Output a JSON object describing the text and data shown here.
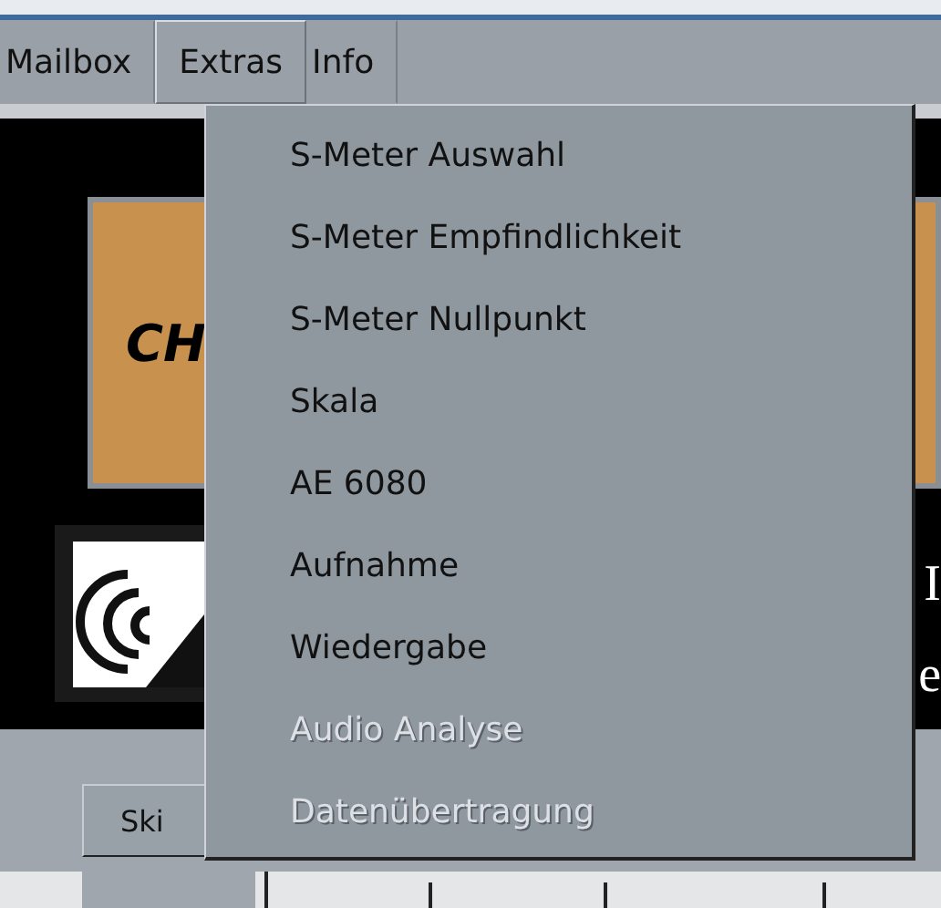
{
  "menubar": [
    {
      "label": "Mailbox",
      "selected": false
    },
    {
      "label": "Extras",
      "selected": true
    },
    {
      "label": "Info",
      "selected": false
    }
  ],
  "dropdown": {
    "items": [
      {
        "label": "S-Meter Auswahl",
        "disabled": false
      },
      {
        "label": "S-Meter Empfindlichkeit",
        "disabled": false
      },
      {
        "label": "S-Meter Nullpunkt",
        "disabled": false
      },
      {
        "label": "Skala",
        "disabled": false
      },
      {
        "label": "AE 6080",
        "disabled": false
      },
      {
        "label": "Aufnahme",
        "disabled": false
      },
      {
        "label": "Wiedergabe",
        "disabled": false
      },
      {
        "label": "Audio Analyse",
        "disabled": true
      },
      {
        "label": "Datenübertragung",
        "disabled": true
      }
    ]
  },
  "background": {
    "panel_text": "CH",
    "right_texts": [
      "I",
      "e"
    ],
    "tab_button": "Ski"
  }
}
